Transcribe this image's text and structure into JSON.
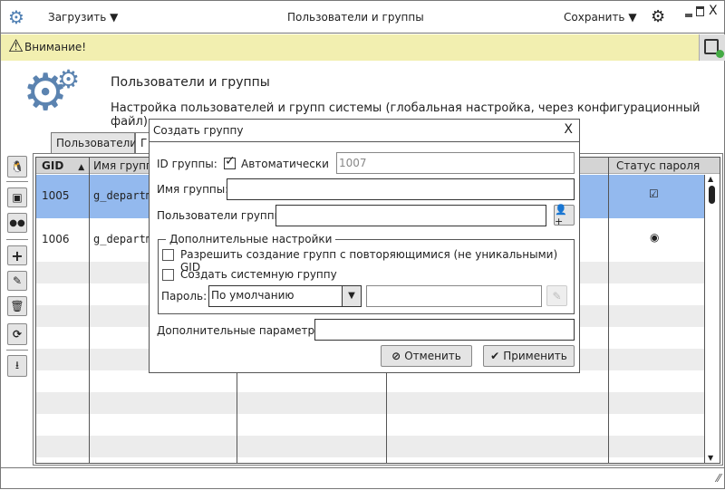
{
  "titlebar": {
    "load": "Загрузить",
    "title": "Пользователи и группы",
    "save": "Сохранить"
  },
  "warning": {
    "text": "Внимание!"
  },
  "header": {
    "title": "Пользователи и группы",
    "subtitle": "Настройка пользователей и групп системы (глобальная настройка, через конфигурационный файл)"
  },
  "tabs": [
    {
      "label": "Пользователи"
    },
    {
      "label": "Г"
    }
  ],
  "table": {
    "columns": [
      "GID",
      "Имя группы",
      "Статус пароля"
    ],
    "rows": [
      {
        "gid": "1005",
        "name": "g_departm",
        "status": "checked"
      },
      {
        "gid": "1006",
        "name": "g_departm",
        "status": "radio"
      }
    ]
  },
  "dialog": {
    "title": "Создать группу",
    "id_label": "ID группы:",
    "auto_label": "Автоматически",
    "id_value": "1007",
    "name_label": "Имя группы:",
    "name_value": "",
    "users_label": "Пользователи группы:",
    "users_value": "",
    "extra_legend": "Дополнительные настройки",
    "allow_dup": "Разрешить создание групп с повторяющимися (не уникальными) GID",
    "system_group": "Создать системную группу",
    "password_label": "Пароль:",
    "password_option": "По умолчанию",
    "password_value": "",
    "params_label": "Дополнительные параметры:",
    "params_value": "",
    "cancel": "Отменить",
    "apply": "Применить"
  }
}
